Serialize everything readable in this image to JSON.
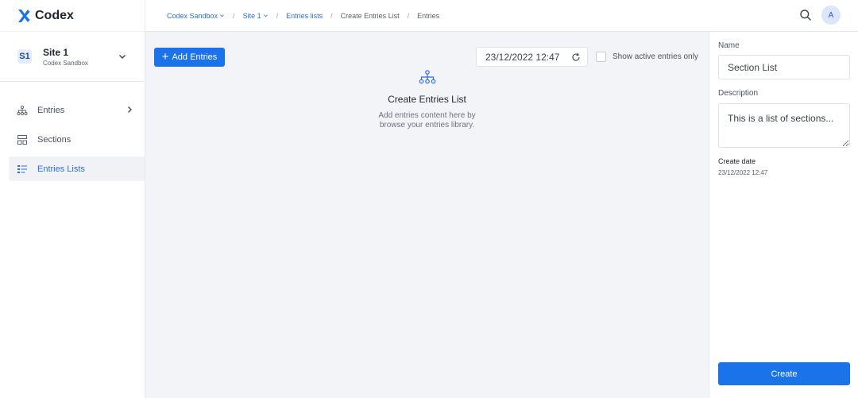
{
  "app": {
    "name": "Codex"
  },
  "site": {
    "badge": "S1",
    "name": "Site 1",
    "org": "Codex Sandbox"
  },
  "nav": {
    "items": [
      {
        "label": "Entries",
        "icon": "hierarchy-icon",
        "has_children": true
      },
      {
        "label": "Sections",
        "icon": "layout-icon",
        "has_children": false
      },
      {
        "label": "Entries Lists",
        "icon": "list-icon",
        "active": true
      }
    ]
  },
  "breadcrumb": [
    {
      "label": "Codex Sandbox",
      "dropdown": true
    },
    {
      "label": "Site 1",
      "dropdown": true
    },
    {
      "label": "Entries lists"
    },
    {
      "label": "Create Entries List"
    },
    {
      "label": "Entries"
    }
  ],
  "user": {
    "initial": "A"
  },
  "toolbar": {
    "add_label": "Add Entries",
    "date_value": "23/12/2022 12:47",
    "active_only_label": "Show active entries only",
    "active_only_checked": false
  },
  "empty_state": {
    "icon": "hierarchy-icon",
    "title": "Create Entries List",
    "description_line1": "Add entries content here by",
    "description_line2": "browse your entries library."
  },
  "panel": {
    "name_label": "Name",
    "name_value": "Section List",
    "description_label": "Description",
    "description_value": "This is a list of sections...",
    "create_date_label": "Create date",
    "create_date_value": "23/12/2022 12:47",
    "create_label": "Create"
  },
  "colors": {
    "accent": "#1a73e8",
    "background": "#f3f4f7"
  }
}
